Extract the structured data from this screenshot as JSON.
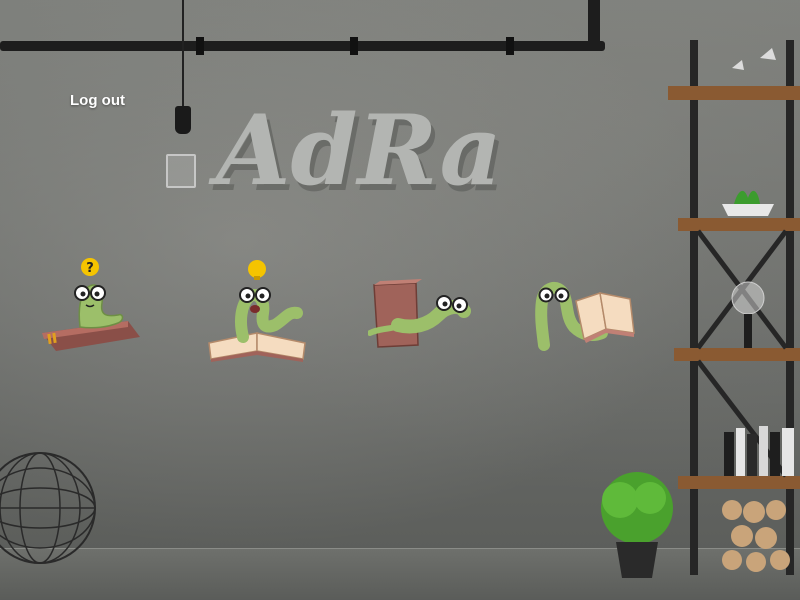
{
  "header": {
    "logout_label": "Log out"
  },
  "logo": {
    "text": "AdRa"
  },
  "levels": [
    {
      "icon": "worm-question-book-icon"
    },
    {
      "icon": "worm-idea-open-book-icon"
    },
    {
      "icon": "worm-holding-book-icon"
    },
    {
      "icon": "worm-reading-book-icon"
    }
  ],
  "colors": {
    "worm": "#9cbf6a",
    "book_brown": "#a0635a",
    "book_pages": "#f5dcc0",
    "badge": "#f5c400",
    "wall": "#6f716e"
  }
}
